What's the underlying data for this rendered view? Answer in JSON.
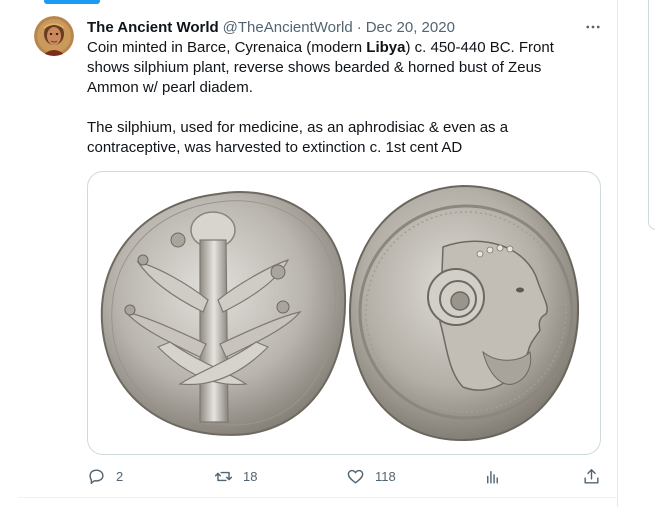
{
  "tweet": {
    "display_name": "The Ancient World",
    "handle": "@TheAncientWorld",
    "separator": "·",
    "date": "Dec 20, 2020",
    "text_line1_a": "Coin minted in Barce, Cyrenaica (modern ",
    "text_line1_bold": "Libya",
    "text_line1_b": ") c. 450-440 BC. Front",
    "text_line2": "shows silphium plant, reverse shows bearded & horned bust of Zeus",
    "text_line3": "Ammon w/ pearl diadem.",
    "text_line4": "The silphium, used for medicine, as an aphrodisiac & even as a",
    "text_line5": "contraceptive, was harvested to extinction c. 1st cent AD"
  },
  "actions": {
    "reply_count": "2",
    "retweet_count": "18",
    "like_count": "118"
  },
  "icons": {
    "more": "more-horizontal-icon",
    "reply": "reply-icon",
    "retweet": "retweet-icon",
    "like": "heart-icon",
    "views": "analytics-icon",
    "share": "share-icon"
  },
  "colors": {
    "accent": "#1d9bf0",
    "text": "#0f1419",
    "muted": "#536471",
    "border": "#cfd9de"
  }
}
